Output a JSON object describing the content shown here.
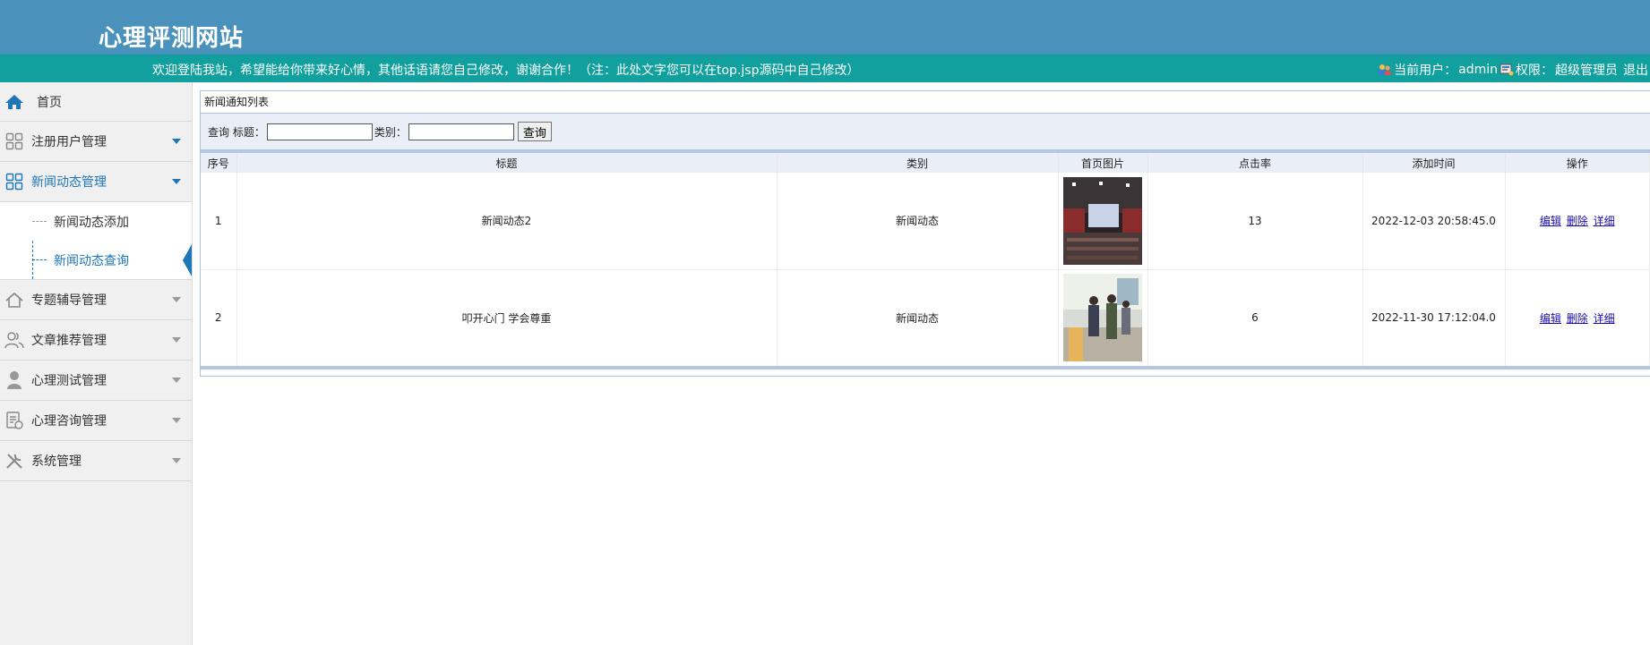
{
  "header": {
    "site_title": "心理评测网站",
    "welcome": "欢迎登陆我站，希望能给你带来好心情，其他话语请您自己修改，谢谢合作！（注：此处文字您可以在top.jsp源码中自己修改）",
    "current_user_label": "当前用户：",
    "current_user": "admin",
    "role_label": "权限：",
    "role": "超级管理员",
    "logout": "退出"
  },
  "sidebar": {
    "home": "首页",
    "items": [
      {
        "label": "注册用户管理",
        "icon": "grid-icon"
      },
      {
        "label": "新闻动态管理",
        "icon": "grid-icon"
      },
      {
        "label": "专题辅导管理",
        "icon": "home-icon"
      },
      {
        "label": "文章推荐管理",
        "icon": "users-icon"
      },
      {
        "label": "心理测试管理",
        "icon": "user-icon"
      },
      {
        "label": "心理咨询管理",
        "icon": "document-icon"
      },
      {
        "label": "系统管理",
        "icon": "tools-icon"
      }
    ],
    "sub_items": [
      "新闻动态添加",
      "新闻动态查询"
    ]
  },
  "panel": {
    "title": "新闻通知列表",
    "search": {
      "prefix": "查询 标题：",
      "category_label": "类别：",
      "title_value": "",
      "category_value": "",
      "button": "查询"
    },
    "columns": [
      "序号",
      "标题",
      "类别",
      "首页图片",
      "点击率",
      "添加时间",
      "操作"
    ],
    "rows": [
      {
        "index": "1",
        "title": "新闻动态2",
        "category": "新闻动态",
        "clicks": "13",
        "time": "2022-12-03 20:58:45.0"
      },
      {
        "index": "2",
        "title": "叩开心门 学会尊重",
        "category": "新闻动态",
        "clicks": "6",
        "time": "2022-11-30 17:12:04.0"
      }
    ],
    "actions": {
      "edit": "编辑",
      "delete": "删除",
      "detail": "详细"
    }
  },
  "colors": {
    "banner": "#4a92bc",
    "topbar": "#11a09d",
    "accent": "#1c76b8"
  }
}
